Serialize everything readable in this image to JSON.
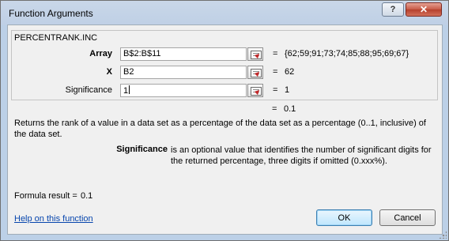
{
  "window": {
    "title": "Function Arguments",
    "help_label": "?",
    "close_label": "✕"
  },
  "function": {
    "name": "PERCENTRANK.INC",
    "args": [
      {
        "label": "Array",
        "bold": true,
        "value": "B$2:B$11",
        "result": "{62;59;91;73;74;85;88;95;69;67}"
      },
      {
        "label": "X",
        "bold": true,
        "value": "B2",
        "result": "62"
      },
      {
        "label": "Significance",
        "bold": false,
        "value": "1",
        "result": "1"
      }
    ],
    "equals": "=",
    "overall_result": "0.1",
    "description": "Returns the rank of a value in a data set as a percentage of the data set as a percentage (0..1, inclusive) of the data set.",
    "param_name": "Significance",
    "param_description": "is an optional value that identifies the number of significant digits for the returned percentage, three digits if omitted (0.xxx%)."
  },
  "formula": {
    "label": "Formula result =",
    "value": "0.1"
  },
  "footer": {
    "help_link": "Help on this function",
    "ok_label": "OK",
    "cancel_label": "Cancel"
  },
  "icons": {
    "ref_button": "collapse-dialog-icon",
    "resize": "resize-grip-icon"
  }
}
